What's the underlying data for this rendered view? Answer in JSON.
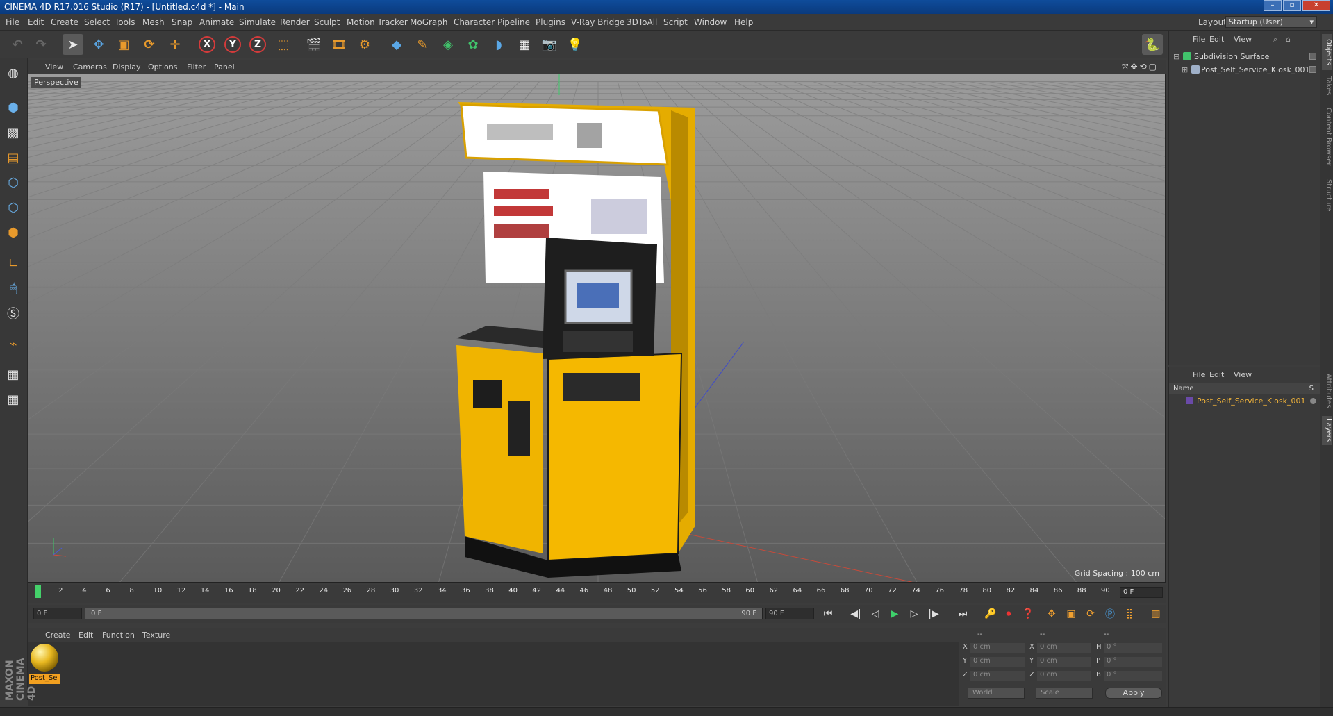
{
  "window": {
    "title": "CINEMA 4D R17.016 Studio (R17) - [Untitled.c4d *] - Main",
    "controls": [
      "–",
      "▫",
      "✕"
    ]
  },
  "menubar": {
    "items": [
      "File",
      "Edit",
      "Create",
      "Select",
      "Tools",
      "Mesh",
      "Snap",
      "Animate",
      "Simulate",
      "Render",
      "Sculpt",
      "Motion Tracker",
      "MoGraph",
      "Character",
      "Pipeline",
      "Plugins",
      "V-Ray Bridge",
      "3DToAll",
      "Script",
      "Window",
      "Help"
    ],
    "layout_label": "Layout:",
    "layout_value": "Startup (User)"
  },
  "toolbar": {
    "axis_x": "X",
    "axis_y": "Y",
    "axis_z": "Z"
  },
  "viewport": {
    "menu": [
      "View",
      "Cameras",
      "Display",
      "Options",
      "Filter",
      "Panel"
    ],
    "camera_label": "Perspective",
    "grid_spacing": "Grid Spacing : 100 cm",
    "nav_icons": "⤧✥⟲▢"
  },
  "timeline": {
    "ticks": [
      "0",
      "2",
      "4",
      "6",
      "8",
      "10",
      "12",
      "14",
      "16",
      "18",
      "20",
      "22",
      "24",
      "26",
      "28",
      "30",
      "32",
      "34",
      "36",
      "38",
      "40",
      "42",
      "44",
      "46",
      "48",
      "50",
      "52",
      "54",
      "56",
      "58",
      "60",
      "62",
      "64",
      "66",
      "68",
      "70",
      "72",
      "74",
      "76",
      "78",
      "80",
      "82",
      "84",
      "86",
      "88",
      "90"
    ],
    "current_frame": "0 F",
    "start_field": "0 F",
    "range_start": "0 F",
    "range_end": "90 F",
    "end_field": "90 F"
  },
  "material_manager": {
    "menu": [
      "Create",
      "Edit",
      "Function",
      "Texture"
    ],
    "material_name": "Post_Se"
  },
  "coordinates": {
    "header_dashes": [
      "--",
      "--",
      "--"
    ],
    "rows": [
      {
        "a": "X",
        "av": "0 cm",
        "b": "X",
        "bv": "0 cm",
        "c": "H",
        "cv": "0 °"
      },
      {
        "a": "Y",
        "av": "0 cm",
        "b": "Y",
        "bv": "0 cm",
        "c": "P",
        "cv": "0 °"
      },
      {
        "a": "Z",
        "av": "0 cm",
        "b": "Z",
        "bv": "0 cm",
        "c": "B",
        "cv": "0 °"
      }
    ],
    "world": "World",
    "scale": "Scale",
    "apply": "Apply"
  },
  "object_manager": {
    "menu": [
      "File",
      "Edit",
      "View"
    ],
    "objects": [
      {
        "name": "Subdivision Surface"
      },
      {
        "name": "Post_Self_Service_Kiosk_001"
      }
    ]
  },
  "layer_manager": {
    "menu": [
      "File",
      "Edit",
      "View"
    ],
    "col_name": "Name",
    "col_s": "S",
    "layer": "Post_Self_Service_Kiosk_001"
  },
  "side_tabs": [
    "Objects",
    "Takes",
    "Content Browser",
    "Structure",
    "Attributes",
    "Layers"
  ],
  "branding": "MAXON CINEMA 4D",
  "colors": {
    "accent_orange": "#f2a020",
    "kiosk_yellow": "#f0b400",
    "play_green": "#3ed06b"
  }
}
